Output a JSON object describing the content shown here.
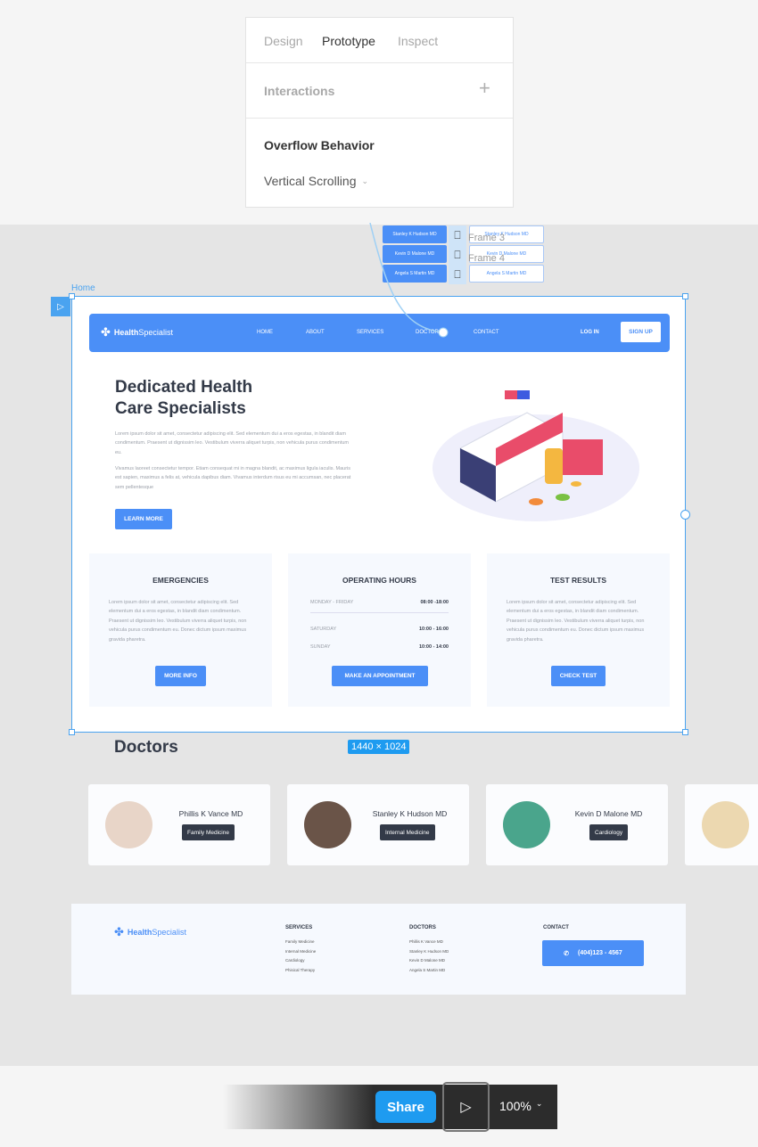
{
  "panel": {
    "tabs": [
      "Design",
      "Prototype",
      "Inspect"
    ],
    "interactions": "Interactions",
    "overflow_title": "Overflow Behavior",
    "overflow_value": "Vertical Scrolling"
  },
  "flow": {
    "frame3": "Frame 3",
    "frame4": "Frame 4",
    "buttons": [
      "Stanley K Hudson MD",
      "Kevin D Malone MD",
      "Angela S Martin MD"
    ]
  },
  "frame": {
    "label": "Home",
    "size": "1440 × 1024"
  },
  "site": {
    "logo_bold": "Health",
    "logo_light": "Specialist",
    "nav": [
      "HOME",
      "ABOUT",
      "SERVICES",
      "DOCTORS",
      "CONTACT"
    ],
    "login": "LOG IN",
    "signup": "SIGN UP",
    "hero_title_1": "Dedicated Health",
    "hero_title_2": "Care Specialists",
    "hero_p1": "Lorem ipsum dolor sit amet, consectetur adipiscing elit. Sed elementum dui a eros egestas, in blandit diam condimentum. Praesent ut dignissim leo. Vestibulum viverra aliquet turpis, non vehicula purus condimentum eu.",
    "hero_p2": "Vivamus laoreet consectetur tempor. Etiam consequat mi in magna blandit, ac maximus ligula iaculis. Mauris est sapien, maximus a felis at, vehicula dapibus diam. Vivamus interdum risus eu mi accumsan, nec placerat sem pellentesque",
    "learn_more": "LEARN MORE",
    "cards": [
      {
        "title": "EMERGENCIES",
        "text": "Lorem ipsum dolor sit amet, consectetur adipiscing elit. Sed elementum dui a eros egestas, in blandit diam condimentum. Praesent ut dignissim leo. Vestibulum viverra aliquet turpis, non vehicula purus condimentum eu. Donec dictum ipsum maximus gravida pharetra.",
        "button": "MORE INFO"
      },
      {
        "title": "OPERATING HOURS",
        "hours": [
          {
            "day": "MONDAY - FRIDAY",
            "time": "08:00 -18:00"
          },
          {
            "day": "SATURDAY",
            "time": "10:00 - 16:00"
          },
          {
            "day": "SUNDAY",
            "time": "10:00 - 14:00"
          }
        ],
        "button": "MAKE AN APPOINTMENT"
      },
      {
        "title": "TEST RESULTS",
        "text": "Lorem ipsum dolor sit amet, consectetur adipiscing elit. Sed elementum dui a eros egestas, in blandit diam condimentum. Praesent ut dignissim leo. Vestibulum viverra aliquet turpis, non vehicula purus condimentum eu. Donec dictum ipsum maximus gravida pharetra.",
        "button": "CHECK TEST"
      }
    ],
    "doctors_title": "Doctors",
    "doctors": [
      {
        "name": "Phillis K Vance MD",
        "spec": "Family Medicine"
      },
      {
        "name": "Stanley K Hudson MD",
        "spec": "Internal Medicine"
      },
      {
        "name": "Kevin D Malone MD",
        "spec": "Cardiology"
      }
    ],
    "footer": {
      "services_h": "SERVICES",
      "services": [
        "Family Medicine",
        "Internal Medicine",
        "Cardiology",
        "Phisical Therapy"
      ],
      "doctors_h": "DOCTORS",
      "doctors": [
        "Phillis K Vance MD",
        "Stanley K Hudson MD",
        "Kevin D Malone MD",
        "Angela S Martin MD"
      ],
      "contact_h": "CONTACT",
      "phone": "(404)123 - 4567"
    }
  },
  "toolbar": {
    "share": "Share",
    "zoom": "100%"
  },
  "colors": {
    "accent": "#4b8ff7",
    "selection": "#4aa3f0",
    "dark": "#333a48"
  }
}
